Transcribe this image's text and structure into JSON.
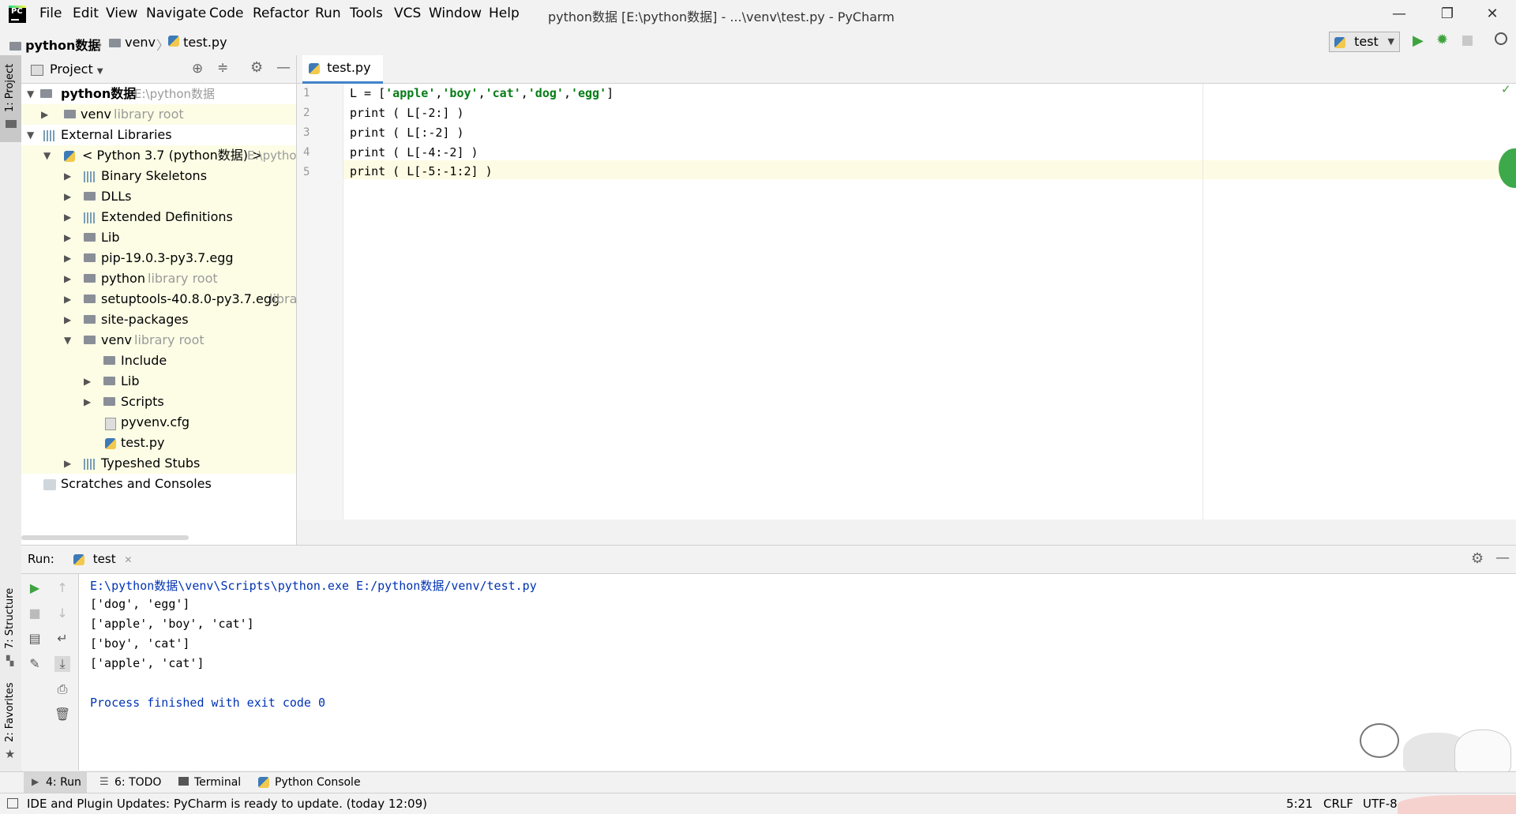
{
  "app": {
    "window_title": "python数据 [E:\\python数据] - ...\\venv\\test.py - PyCharm",
    "logo_text": "PC"
  },
  "menu": [
    "File",
    "Edit",
    "View",
    "Navigate",
    "Code",
    "Refactor",
    "Run",
    "Tools",
    "VCS",
    "Window",
    "Help"
  ],
  "window_controls": {
    "minimize": "—",
    "restore": "❐",
    "close": "✕"
  },
  "breadcrumb": {
    "project": "python数据",
    "folder": "venv",
    "file": "test.py"
  },
  "run_config": {
    "name": "test"
  },
  "left_strip": {
    "project": "1: Project",
    "structure": "7: Structure",
    "favorites": "2: Favorites"
  },
  "project_panel": {
    "title": "Project",
    "tree": [
      {
        "label": "python数据",
        "hint": "E:\\python数据"
      },
      {
        "label": "venv",
        "hint": "library root"
      },
      {
        "label": "External Libraries",
        "hint": ""
      },
      {
        "label": "< Python 3.7 (python数据) >",
        "hint": "E:\\pytho"
      },
      {
        "label": "Binary Skeletons",
        "hint": ""
      },
      {
        "label": "DLLs",
        "hint": ""
      },
      {
        "label": "Extended Definitions",
        "hint": ""
      },
      {
        "label": "Lib",
        "hint": ""
      },
      {
        "label": "pip-19.0.3-py3.7.egg",
        "hint": ""
      },
      {
        "label": "python",
        "hint": "library root"
      },
      {
        "label": "setuptools-40.8.0-py3.7.egg",
        "hint": "libra"
      },
      {
        "label": "site-packages",
        "hint": ""
      },
      {
        "label": "venv",
        "hint": "library root"
      },
      {
        "label": "Include",
        "hint": ""
      },
      {
        "label": "Lib",
        "hint": ""
      },
      {
        "label": "Scripts",
        "hint": ""
      },
      {
        "label": "pyvenv.cfg",
        "hint": ""
      },
      {
        "label": "test.py",
        "hint": ""
      },
      {
        "label": "Typeshed Stubs",
        "hint": ""
      },
      {
        "label": "Scratches and Consoles",
        "hint": ""
      }
    ]
  },
  "editor": {
    "tab": "test.py",
    "line_numbers": [
      "1",
      "2",
      "3",
      "4",
      "5"
    ],
    "lines": [
      {
        "pre": "L = [",
        "s1": "'apple'",
        "c1": ",",
        "s2": "'boy'",
        "c2": ",",
        "s3": "'cat'",
        "c3": ",",
        "s4": "'dog'",
        "c4": ",",
        "s5": "'egg'",
        "post": "]"
      },
      {
        "text": "print ( L[-2:] )"
      },
      {
        "text": "print ( L[:-2] )"
      },
      {
        "text": "print ( L[-4:-2] )"
      },
      {
        "text": "print ( L[-5:-1:2] )"
      }
    ]
  },
  "run_panel": {
    "label": "Run:",
    "tab": "test",
    "output": [
      "E:\\python数据\\venv\\Scripts\\python.exe E:/python数据/venv/test.py",
      "['dog', 'egg']",
      "['apple', 'boy', 'cat']",
      "['boy', 'cat']",
      "['apple', 'cat']",
      "",
      "Process finished with exit code 0"
    ]
  },
  "bottom_tabs": [
    "4: Run",
    "6: TODO",
    "Terminal",
    "Python Console"
  ],
  "status": {
    "message": "IDE and Plugin Updates: PyCharm is ready to update. (today 12:09)",
    "position": "5:21",
    "line_sep": "CRLF",
    "encoding": "UTF-8"
  },
  "colors": {
    "accent": "#3d7ab8",
    "string": "#067d17",
    "console_blue": "#0033b3",
    "tree_highlight": "#fdfde6"
  }
}
